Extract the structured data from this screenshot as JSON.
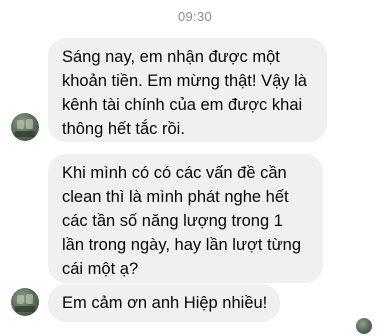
{
  "conversation": {
    "timestamp": "09:30",
    "messages": [
      {
        "sender": "contact",
        "text": "Sáng nay, em nhận được một\nkhoản tiền. Em mừng thật! Vậy là\nkênh tài chính của em được khai\nthông hết tắc rồi."
      },
      {
        "sender": "contact",
        "text": "Khi mình có có các vấn đề cần\nclean thì là mình phát nghe hết\ncác tần số năng lượng trong 1\nlần trong ngày, hay lần lượt từng\ncái một ạ?"
      },
      {
        "sender": "contact",
        "text": "Em cảm ơn anh Hiệp nhiều!"
      }
    ]
  },
  "colors": {
    "bubble_background": "#f0f0f0",
    "message_text": "#050505",
    "timestamp_text": "#8a8d91"
  },
  "icons": {
    "contact_avatar": "avatar",
    "read_receipt": "seen-avatar-icon"
  }
}
